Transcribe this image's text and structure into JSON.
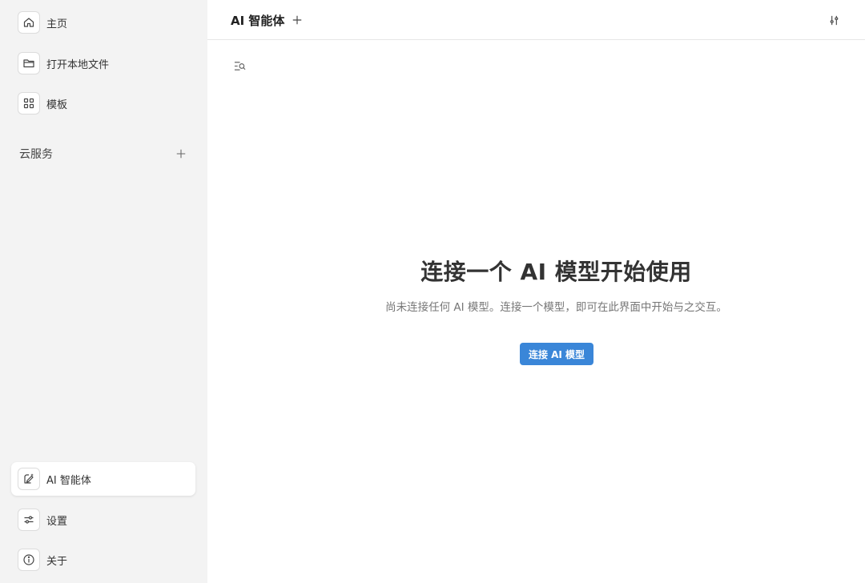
{
  "sidebar": {
    "top_items": [
      {
        "label": "主页",
        "icon": "home-icon"
      },
      {
        "label": "打开本地文件",
        "icon": "folder-icon"
      },
      {
        "label": "模板",
        "icon": "grid-icon"
      }
    ],
    "section": {
      "title": "云服务",
      "add_icon": "plus-icon"
    },
    "bottom_items": [
      {
        "label": "AI 智能体",
        "icon": "ai-agent-icon",
        "active": true
      },
      {
        "label": "设置",
        "icon": "sliders-icon"
      },
      {
        "label": "关于",
        "icon": "info-icon"
      }
    ]
  },
  "header": {
    "tab_title": "AI 智能体",
    "add_icon": "plus-icon",
    "settings_icon": "sliders-vertical-icon"
  },
  "toolbar": {
    "search_list_icon": "search-list-icon"
  },
  "empty_state": {
    "title": "连接一个 AI 模型开始使用",
    "description": "尚未连接任何 AI 模型。连接一个模型，即可在此界面中开始与之交互。",
    "button_label": "连接 AI 模型"
  },
  "colors": {
    "sidebar_bg": "#f3f3f3",
    "accent": "#3a86d8"
  }
}
